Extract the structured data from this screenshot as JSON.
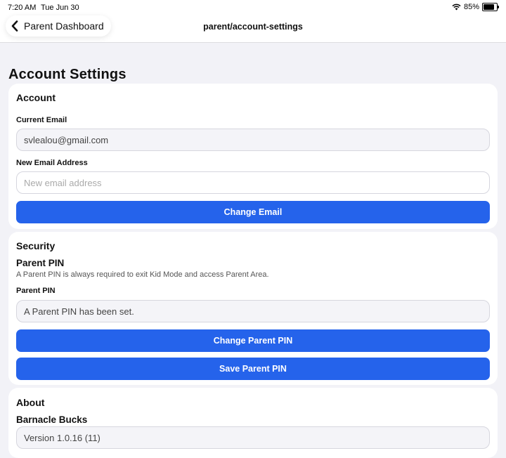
{
  "status": {
    "time": "7:20 AM",
    "date": "Tue Jun 30",
    "battery": "85%"
  },
  "nav": {
    "back_label": "Parent Dashboard",
    "path": "parent/account-settings"
  },
  "page": {
    "title": "Account Settings"
  },
  "account": {
    "heading": "Account",
    "current_email_label": "Current Email",
    "current_email": "svlealou@gmail.com",
    "new_email_label": "New Email Address",
    "new_email_placeholder": "New email address",
    "change_email_button": "Change Email"
  },
  "security": {
    "heading": "Security",
    "pin_title": "Parent PIN",
    "pin_help": "A Parent PIN is always required to exit Kid Mode and access Parent Area.",
    "pin_label": "Parent PIN",
    "pin_status": "A Parent PIN has been set.",
    "change_pin_button": "Change Parent PIN",
    "save_pin_button": "Save Parent PIN"
  },
  "about": {
    "heading": "About",
    "app_name": "Barnacle Bucks",
    "version": "Version 1.0.16 (11)"
  },
  "colors": {
    "accent": "#2563eb",
    "background": "#f2f2f7"
  }
}
